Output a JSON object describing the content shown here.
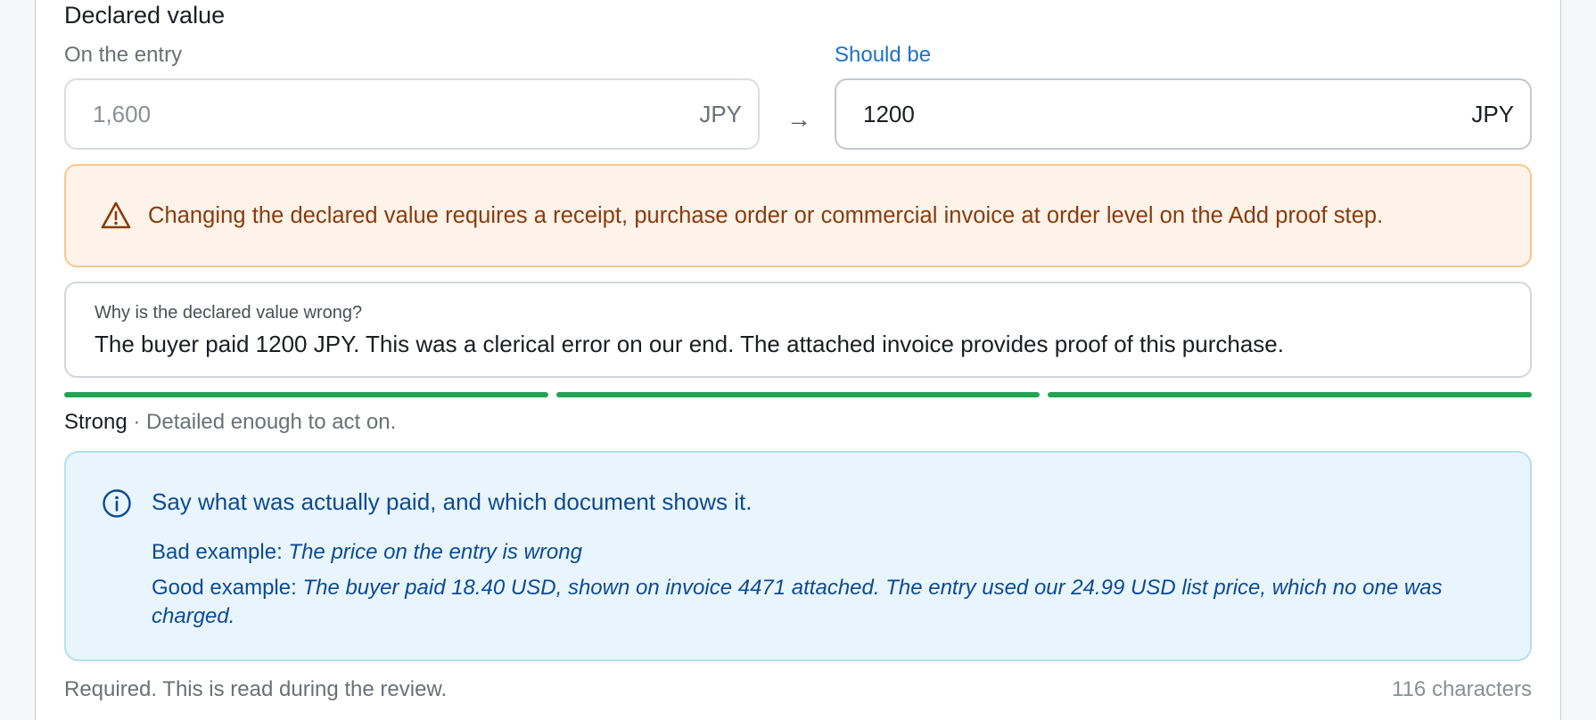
{
  "section": {
    "title": "Declared value"
  },
  "entry": {
    "label": "On the entry",
    "value": "1,600",
    "currency": "JPY"
  },
  "corrected": {
    "label": "Should be",
    "value": "1200",
    "currency": "JPY"
  },
  "arrow_glyph": "→",
  "warning": {
    "icon": "warning-triangle-icon",
    "text": "Changing the declared value requires a receipt, purchase order or commercial invoice at order level on the Add proof step.",
    "color": "#8a3a0e"
  },
  "reason": {
    "question": "Why is the declared value wrong?",
    "answer": "The buyer paid 1200 JPY. This was a clerical error on our end. The attached invoice provides proof of this purchase."
  },
  "strength": {
    "level": "Strong",
    "description": " · Detailed enough to act on.",
    "segments_filled": 3,
    "segments_total": 3,
    "color": "#23a455"
  },
  "tip": {
    "icon": "info-icon",
    "headline": "Say what was actually paid, and which document shows it.",
    "bad_label": "Bad example: ",
    "bad_text": "The price on the entry is wrong",
    "good_label": "Good example: ",
    "good_text": "The buyer paid 18.40 USD, shown on invoice 4471 attached. The entry used our 24.99 USD list price, which no one was charged."
  },
  "footer": {
    "required_note": "Required. This is read during the review.",
    "char_count": "116 characters"
  }
}
